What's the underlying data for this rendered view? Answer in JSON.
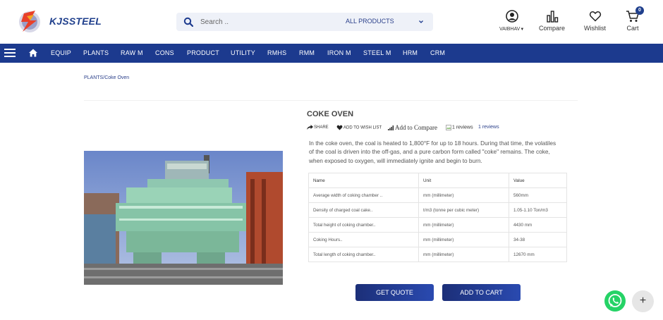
{
  "brand": {
    "name": "KJSSTEEL"
  },
  "search": {
    "placeholder": "Search ..",
    "category": "ALL PRODUCTS"
  },
  "header_actions": {
    "account": "VAIBHAV",
    "compare": "Compare",
    "wishlist": "Wishlist",
    "cart": "Cart",
    "cart_count": "0"
  },
  "nav": {
    "items": [
      "EQUIP",
      "PLANTS",
      "RAW M",
      "CONS",
      "PRODUCT",
      "UTILITY",
      "RMHS",
      "RMM",
      "IRON M",
      "STEEL M",
      "HRM",
      "CRM"
    ]
  },
  "breadcrumb": {
    "parent": "PLANTS",
    "separator": "/",
    "current": "Coke Oven"
  },
  "product": {
    "title": "COKE OVEN",
    "share": "SHARE",
    "wishlist": "ADD TO WISH LIST",
    "compare": "Add to Compare",
    "rating_img_alt": "1 reviews",
    "reviews_link": "1 reviews",
    "description": "In the coke oven, the coal is heated to 1,800°F for up to 18 hours. During that time, the volatiles of the coal is driven into the off-gas, and a pure carbon form called \"coke\" remains. The coke, when exposed to oxygen, will immediately ignite and begin to burn."
  },
  "specs": {
    "headers": [
      "Name",
      "Unit",
      "Value"
    ],
    "rows": [
      [
        "Average width of coking chamber ..",
        "mm (millimeter)",
        "560mm"
      ],
      [
        "Density of charged coal cake..",
        "t/m3 (tonne per cubic meter)",
        "1.05-1.10 Ton/m3"
      ],
      [
        "Total height of coking chamber..",
        "mm (millimeter)",
        "4430 mm"
      ],
      [
        "Coking Hours..",
        "mm (millimeter)",
        "34-38"
      ],
      [
        "Total length of coking chamber..",
        "mm (millimeter)",
        "12670 mm"
      ]
    ]
  },
  "buttons": {
    "quote": "GET QUOTE",
    "cart": "ADD TO CART"
  },
  "fab": {
    "plus": "+"
  },
  "colors": {
    "primary": "#1c3a8e",
    "whatsapp": "#25d366"
  }
}
